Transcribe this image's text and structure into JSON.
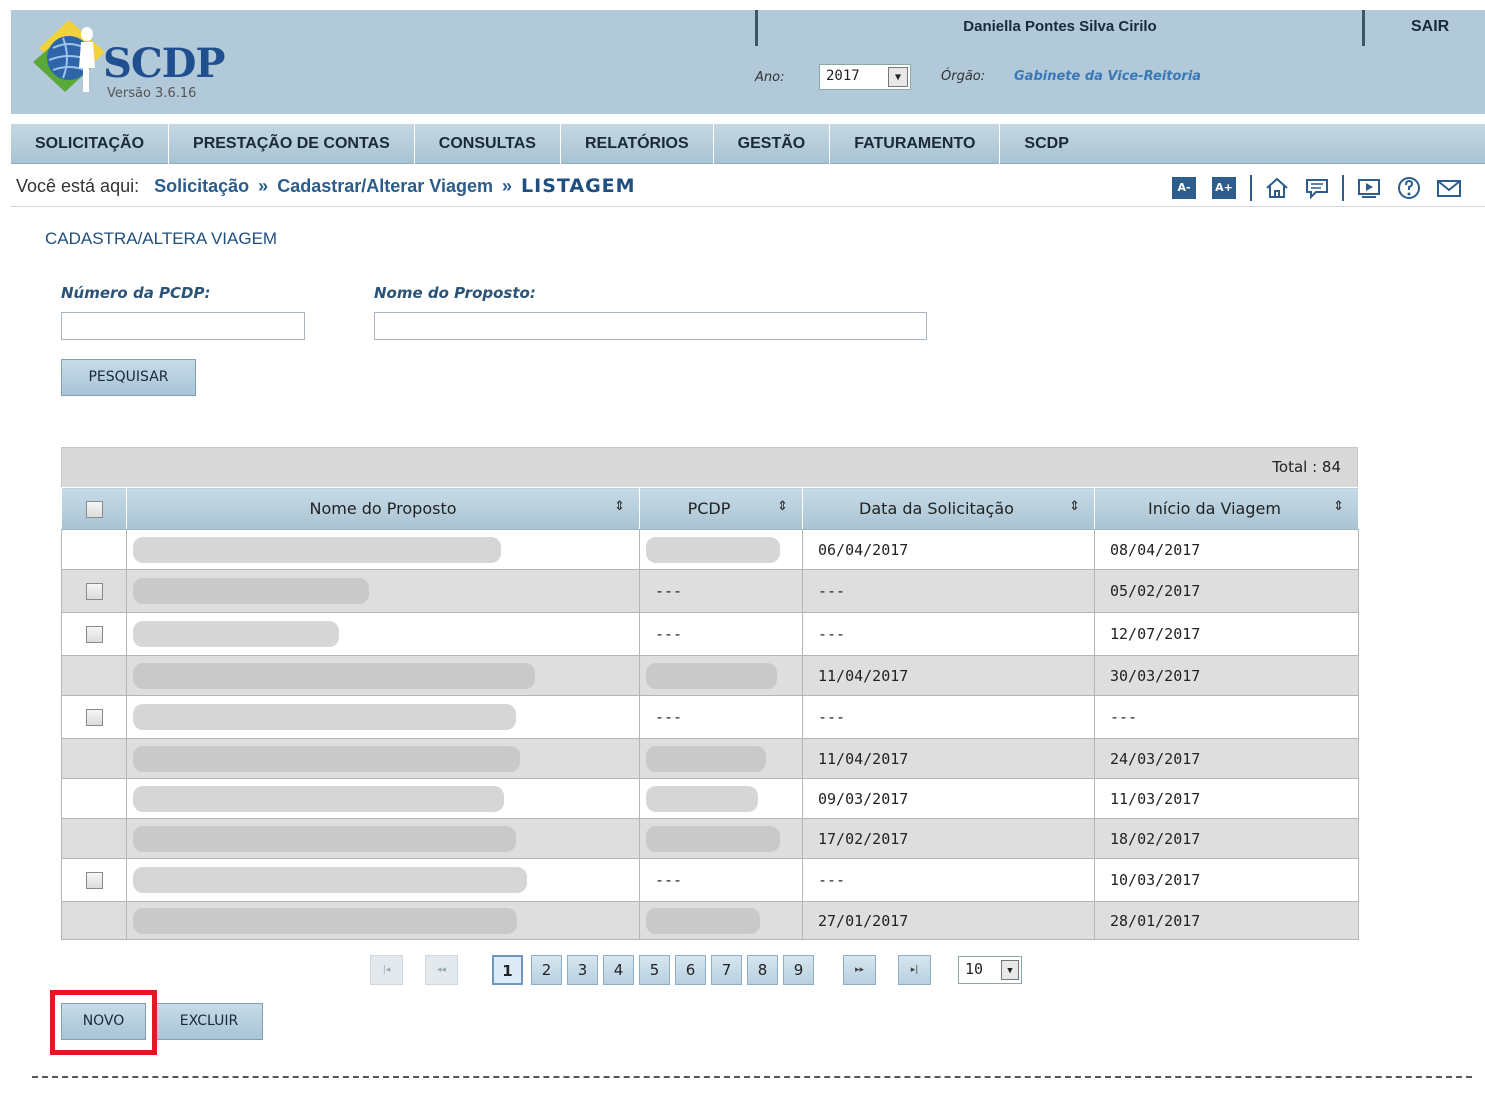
{
  "header": {
    "logo_text": "SCDP",
    "version": "Versão 3.6.16",
    "user_name": "Daniella Pontes Silva Cirilo",
    "logout_label": "SAIR",
    "ano_label": "Ano:",
    "ano_value": "2017",
    "orgao_label": "Órgão:",
    "orgao_value": "Gabinete da Vice-Reitoria"
  },
  "menu": {
    "items": [
      "SOLICITAÇÃO",
      "PRESTAÇÃO DE CONTAS",
      "CONSULTAS",
      "RELATÓRIOS",
      "GESTÃO",
      "FATURAMENTO",
      "SCDP"
    ]
  },
  "breadcrumb": {
    "prefix": "Você está aqui:",
    "items": [
      "Solicitação",
      "Cadastrar/Alterar Viagem"
    ],
    "current": "LISTAGEM",
    "separator": "»"
  },
  "toolbar": {
    "font_decrease": "A-",
    "font_increase": "A+",
    "icons": [
      "home-icon",
      "chat-icon",
      "video-icon",
      "help-icon",
      "mail-icon"
    ]
  },
  "form": {
    "section_title": "CADASTRA/ALTERA VIAGEM",
    "pcdp_label": "Número da PCDP:",
    "pcdp_value": "",
    "proposto_label": "Nome do Proposto:",
    "proposto_value": "",
    "search_button": "PESQUISAR"
  },
  "table": {
    "total_label": "Total : 84",
    "columns": [
      "Nome do Proposto",
      "PCDP",
      "Data da Solicitação",
      "Início da Viagem"
    ],
    "rows": [
      {
        "checkbox": false,
        "pcdp": "",
        "data": "06/04/2017",
        "inicio": "08/04/2017"
      },
      {
        "checkbox": true,
        "pcdp": "---",
        "data": "---",
        "inicio": "05/02/2017"
      },
      {
        "checkbox": true,
        "pcdp": "---",
        "data": "---",
        "inicio": "12/07/2017"
      },
      {
        "checkbox": false,
        "pcdp": "",
        "data": "11/04/2017",
        "inicio": "30/03/2017"
      },
      {
        "checkbox": true,
        "pcdp": "---",
        "data": "---",
        "inicio": "---"
      },
      {
        "checkbox": false,
        "pcdp": "",
        "data": "11/04/2017",
        "inicio": "24/03/2017"
      },
      {
        "checkbox": false,
        "pcdp": "",
        "data": "09/03/2017",
        "inicio": "11/03/2017"
      },
      {
        "checkbox": false,
        "pcdp": "",
        "data": "17/02/2017",
        "inicio": "18/02/2017"
      },
      {
        "checkbox": true,
        "pcdp": "---",
        "data": "---",
        "inicio": "10/03/2017"
      },
      {
        "checkbox": false,
        "pcdp": "",
        "data": "27/01/2017",
        "inicio": "28/01/2017"
      }
    ]
  },
  "pagination": {
    "first": "|◂",
    "prev": "◂◂",
    "pages": [
      "1",
      "2",
      "3",
      "4",
      "5",
      "6",
      "7",
      "8",
      "9"
    ],
    "active_page": "1",
    "next": "▸▸",
    "last": "▸|",
    "page_size": "10"
  },
  "actions": {
    "new_button": "NOVO",
    "delete_button": "EXCLUIR"
  },
  "colors": {
    "header_bg": "#b1c9d8",
    "accent": "#2d5d8c",
    "highlight": "#e01a22"
  }
}
